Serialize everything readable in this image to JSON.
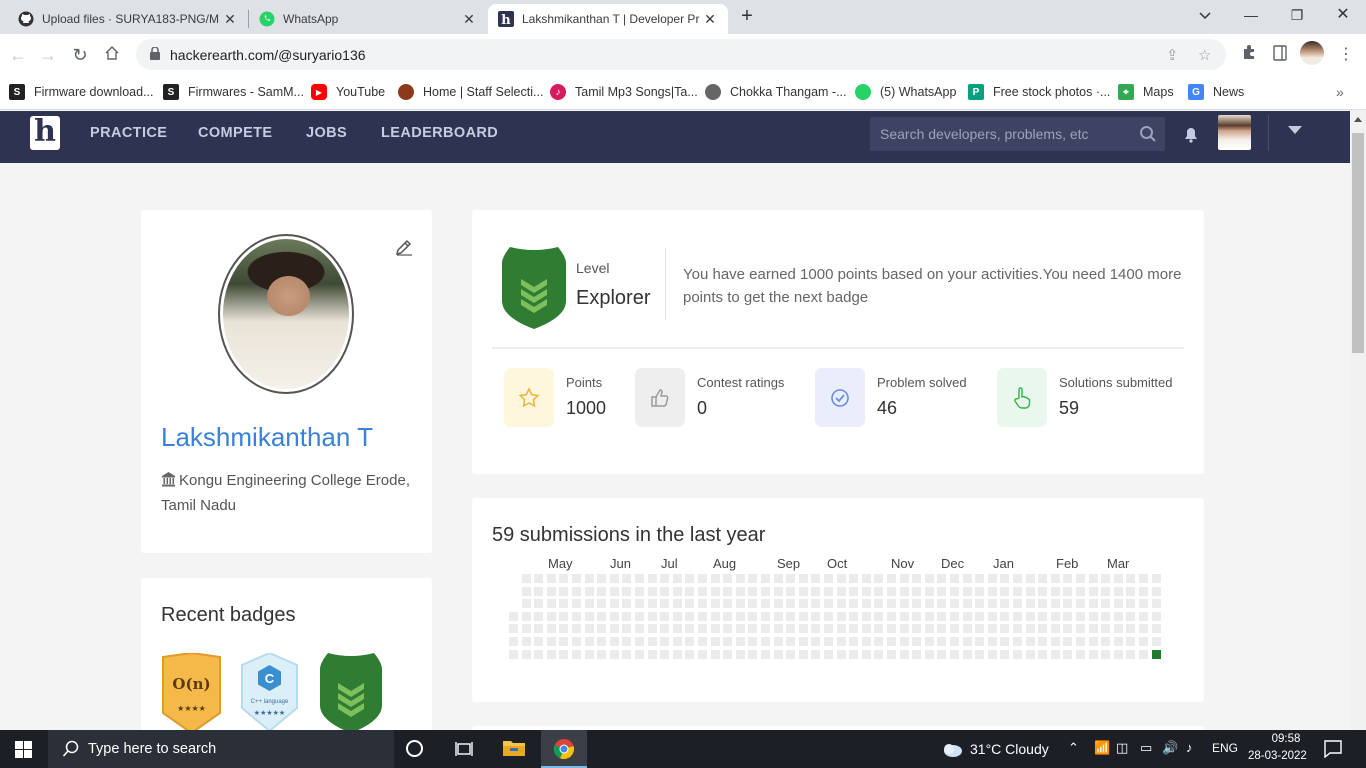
{
  "browser": {
    "tabs": [
      {
        "title": "Upload files · SURYA183-PNG/M",
        "icon": "github-icon"
      },
      {
        "title": "WhatsApp",
        "icon": "whatsapp-icon"
      },
      {
        "title": "Lakshmikanthan T | Developer Pr",
        "icon": "hackerearth-icon",
        "active": true
      }
    ],
    "url": "hackerearth.com/@suryario136",
    "bookmarks": [
      {
        "label": "Firmware download...",
        "color": "#222222"
      },
      {
        "label": "Firmwares - SamM...",
        "color": "#222222"
      },
      {
        "label": "YouTube",
        "color": "#ff0000"
      },
      {
        "label": "Home | Staff Selecti...",
        "color": "#8b3a1a"
      },
      {
        "label": "Tamil Mp3 Songs|Ta...",
        "color": "#d81b60"
      },
      {
        "label": "Chokka Thangam -...",
        "color": "#444444"
      },
      {
        "label": "(5) WhatsApp",
        "color": "#25d366"
      },
      {
        "label": "Free stock photos ·...",
        "color": "#05a081"
      },
      {
        "label": "Maps",
        "color": "#34a853"
      },
      {
        "label": "News",
        "color": "#4285f4"
      }
    ],
    "bookmarks_more": "»"
  },
  "site": {
    "logo": "h",
    "nav": [
      "PRACTICE",
      "COMPETE",
      "JOBS",
      "LEADERBOARD"
    ],
    "search_placeholder": "Search developers, problems, etc"
  },
  "profile": {
    "name": "Lakshmikanthan T",
    "institution": "Kongu Engineering College Erode, Tamil Nadu"
  },
  "level": {
    "label": "Level",
    "name": "Explorer",
    "message": "You have earned 1000 points based on your activities.You need 1400 more points to get the next badge"
  },
  "stats": [
    {
      "label": "Points",
      "value": "1000",
      "icon": "star-icon",
      "bg": "#fff6de",
      "color": "#f0b43a"
    },
    {
      "label": "Contest ratings",
      "value": "0",
      "icon": "thumbs-up-icon",
      "bg": "#eeeeee",
      "color": "#9a9a9a"
    },
    {
      "label": "Problem solved",
      "value": "46",
      "icon": "check-circle-icon",
      "bg": "#eaeefc",
      "color": "#6c8ce0"
    },
    {
      "label": "Solutions submitted",
      "value": "59",
      "icon": "pointer-hand-icon",
      "bg": "#e9f7ec",
      "color": "#37b24d"
    }
  ],
  "submissions": {
    "title": "59 submissions in the last year",
    "months": [
      "May",
      "Jun",
      "Jul",
      "Aug",
      "Sep",
      "Oct",
      "Nov",
      "Dec",
      "Jan",
      "Feb",
      "Mar"
    ]
  },
  "recent_badges": {
    "title": "Recent badges",
    "items": [
      {
        "text": "O(n)",
        "stars": "★★★★",
        "bg": "#f5b94a"
      },
      {
        "text": "C",
        "caption": "C++ language",
        "stars": "★★★★★",
        "bg": "#dceef8"
      },
      {
        "text": "",
        "bg": "#2e7d32"
      }
    ]
  },
  "taskbar": {
    "search_text": "Type here to search",
    "weather": "31°C  Cloudy",
    "language": "ENG",
    "time": "09:58",
    "date": "28-03-2022"
  }
}
